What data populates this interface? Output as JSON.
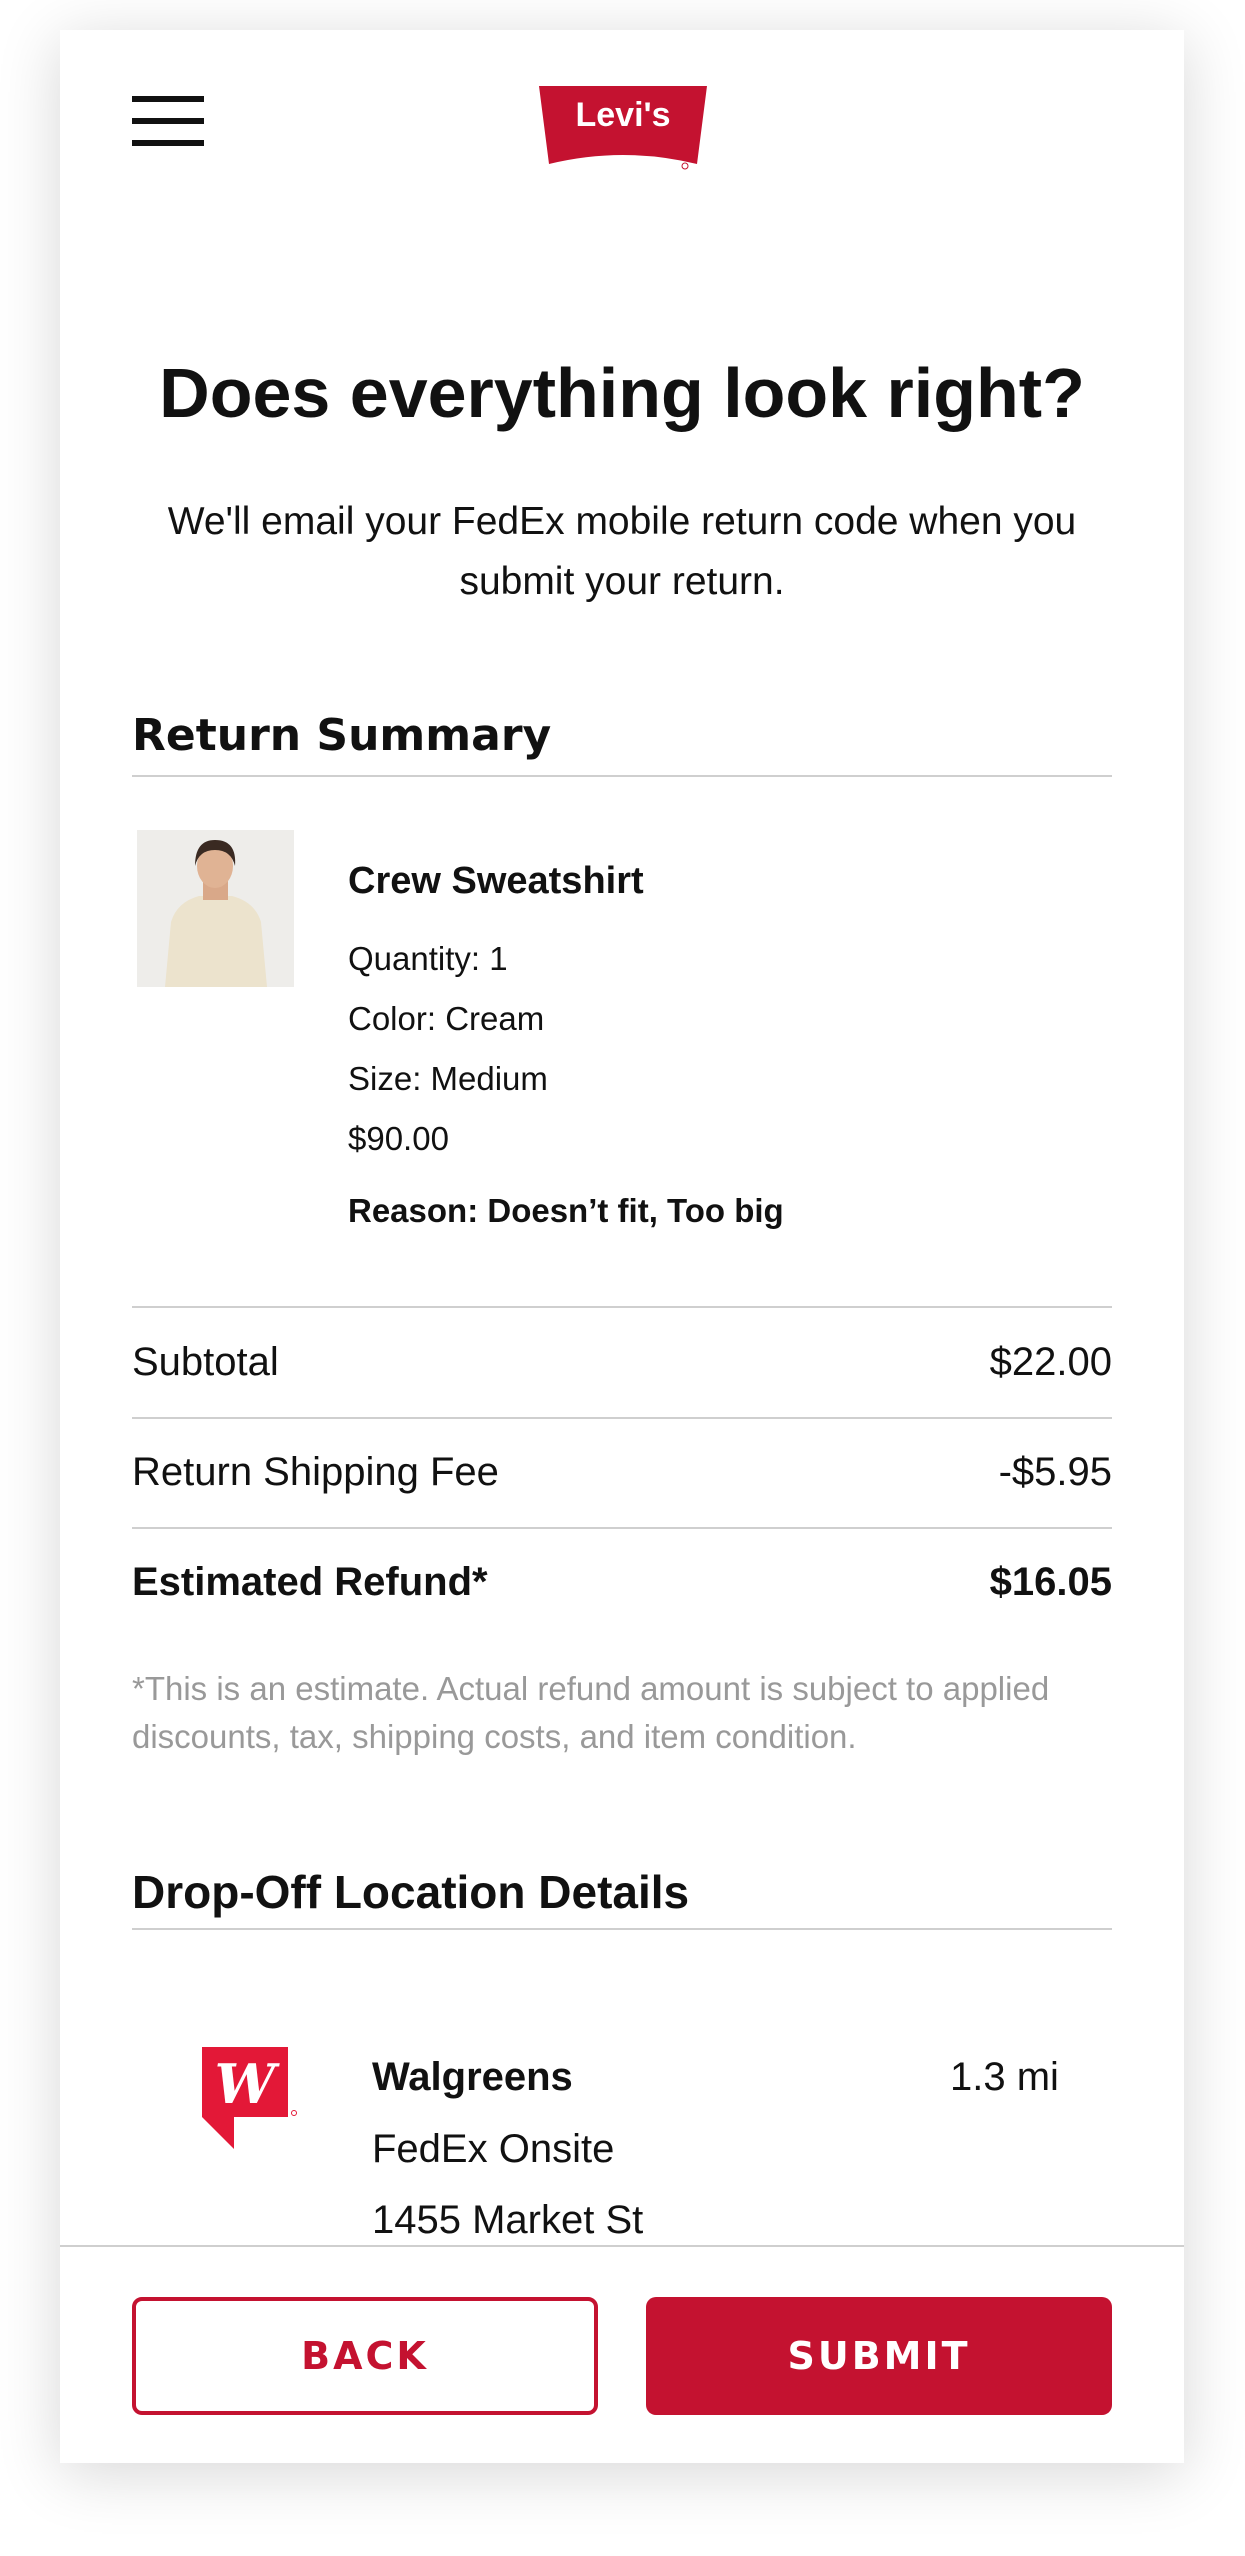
{
  "header": {
    "logo_text": "Levi's",
    "brand_color": "#c41230",
    "menu_icon": "hamburger-menu-icon"
  },
  "page": {
    "title": "Does everything look right?",
    "subtitle": "We'll email your FedEx mobile return code when you submit your return."
  },
  "summary": {
    "heading": "Return Summary",
    "item": {
      "name": "Crew Sweatshirt",
      "quantity": "Quantity: 1",
      "color": "Color: Cream",
      "size": "Size: Medium",
      "price": "$90.00",
      "reason": "Reason: Doesn’t fit, Too big"
    },
    "rows": [
      {
        "label": "Subtotal",
        "value": "$22.00"
      },
      {
        "label": "Return Shipping Fee",
        "value": "-$5.95"
      },
      {
        "label": "Estimated Refund*",
        "value": "$16.05"
      }
    ],
    "disclaimer": "*This is an estimate. Actual refund amount is subject to applied discounts, tax, shipping costs, and item condition."
  },
  "dropoff": {
    "heading": "Drop-Off Location Details",
    "location": {
      "name": "Walgreens",
      "distance": "1.3 mi",
      "type": "FedEx Onsite",
      "address": "1455 Market St",
      "icon": "walgreens-logo-icon"
    }
  },
  "footer": {
    "back_label": "BACK",
    "submit_label": "SUBMIT"
  }
}
